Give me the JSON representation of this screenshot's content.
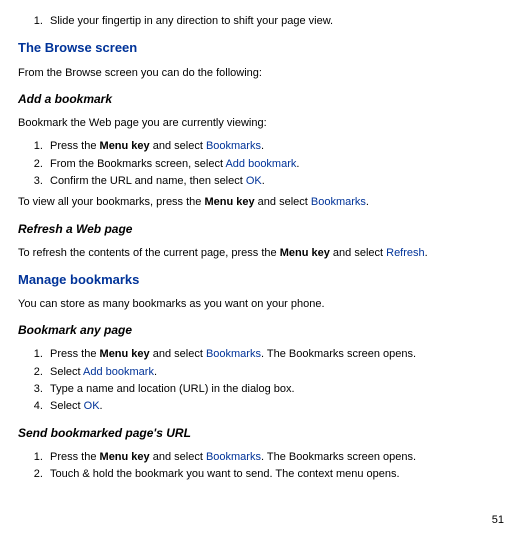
{
  "intro_step": "Slide your fingertip in any direction to shift your page view.",
  "browse": {
    "title": "The Browse screen",
    "intro": "From the Browse screen you can do the following:",
    "add_bookmark": {
      "title": "Add a bookmark",
      "lead": "Bookmark the Web page you are currently viewing:",
      "step1_pre": "Press the ",
      "step1_bold": "Menu key",
      "step1_mid": " and select ",
      "step1_link": "Bookmarks",
      "step1_post": ".",
      "step2_pre": "From the Bookmarks screen, select ",
      "step2_link": "Add bookmark",
      "step2_post": ".",
      "step3_pre": "Confirm the URL and name, then select ",
      "step3_link": "OK",
      "step3_post": ".",
      "view_pre": "To view all your bookmarks, press the ",
      "view_bold": "Menu key",
      "view_mid": " and select ",
      "view_link": "Bookmarks",
      "view_post": "."
    },
    "refresh": {
      "title": "Refresh a Web page",
      "pre": "To refresh the contents of the current page, press the ",
      "bold": "Menu key",
      "mid": " and select ",
      "link": "Refresh",
      "post": "."
    }
  },
  "manage": {
    "title": "Manage bookmarks",
    "intro": "You can store as many bookmarks as you want on your phone.",
    "any_page": {
      "title": "Bookmark any page",
      "step1_pre": "Press the ",
      "step1_bold": "Menu key",
      "step1_mid": " and select ",
      "step1_link": "Bookmarks",
      "step1_post": ". The Bookmarks screen opens.",
      "step2_pre": "Select ",
      "step2_link": "Add bookmark",
      "step2_post": ".",
      "step3": "Type a name and location (URL) in the dialog box.",
      "step4_pre": "Select ",
      "step4_link": "OK",
      "step4_post": "."
    },
    "send_url": {
      "title": "Send bookmarked page's URL",
      "step1_pre": "Press the ",
      "step1_bold": "Menu key",
      "step1_mid": " and select ",
      "step1_link": "Bookmarks",
      "step1_post": ". The Bookmarks screen opens.",
      "step2": "Touch & hold the bookmark you want to send. The context menu opens."
    }
  },
  "page_number": "51"
}
